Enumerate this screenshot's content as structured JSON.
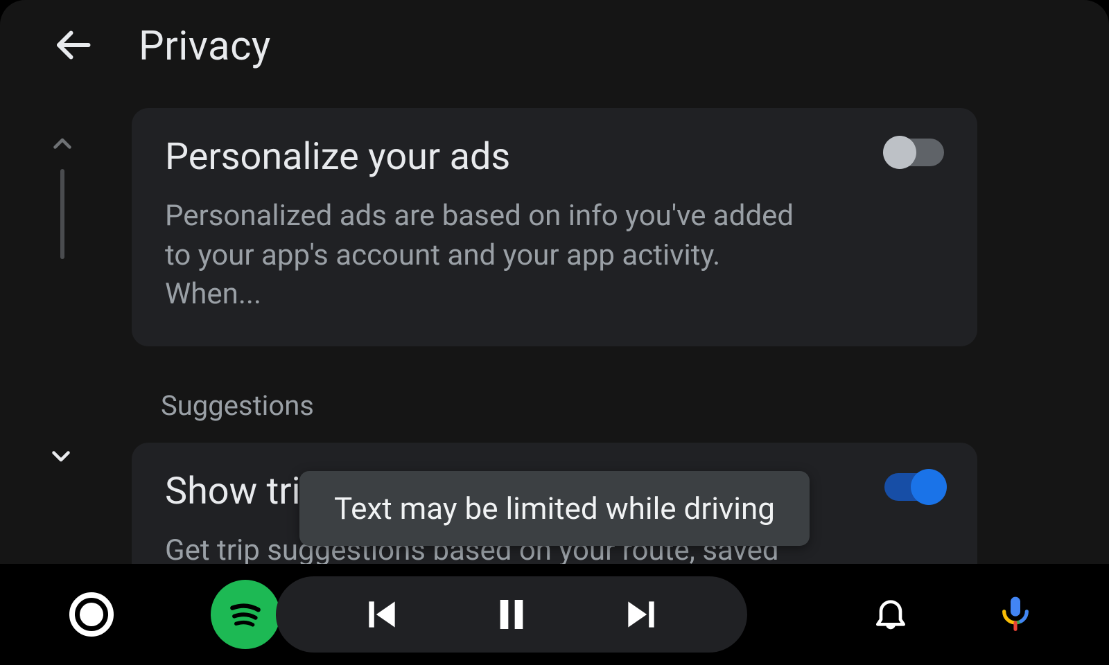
{
  "header": {
    "title": "Privacy"
  },
  "settings": {
    "personalize_ads": {
      "title": "Personalize your ads",
      "description": "Personalized ads are based on info you've added to your app's account and your app activity. When...",
      "enabled": false
    },
    "section_suggestions_label": "Suggestions",
    "trip_suggestion": {
      "title": "Show trip suggestion",
      "description": "Get trip suggestions based on your route, saved places, and past drives.",
      "enabled": true
    }
  },
  "toast": {
    "message": "Text may be limited while driving"
  },
  "navbar": {
    "app": "spotify"
  }
}
